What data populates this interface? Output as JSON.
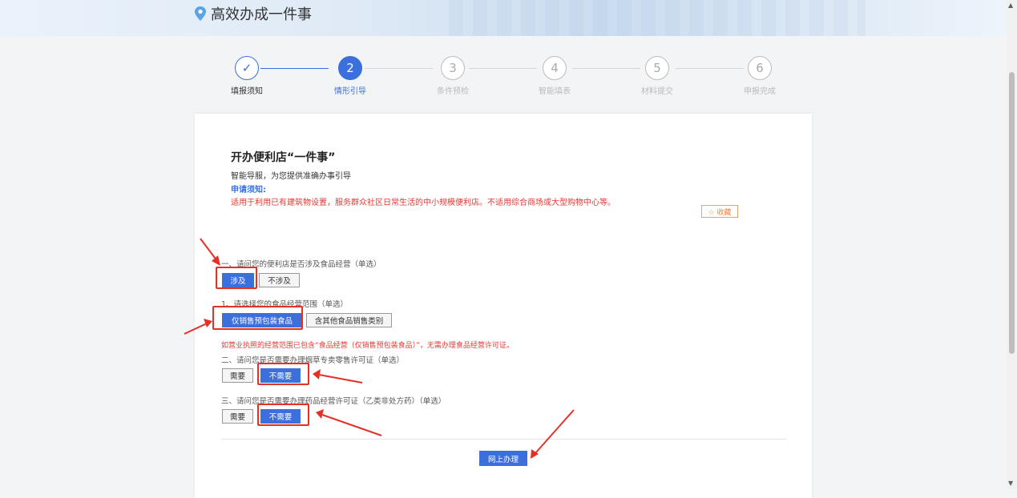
{
  "header": {
    "title": "高效办成一件事",
    "icon": "location-pin-icon"
  },
  "steps": [
    {
      "label": "填报须知",
      "number": "✓",
      "status": "done"
    },
    {
      "label": "情形引导",
      "number": "2",
      "status": "active"
    },
    {
      "label": "条件预检",
      "number": "3",
      "status": "pending"
    },
    {
      "label": "智能填表",
      "number": "4",
      "status": "pending"
    },
    {
      "label": "材料提交",
      "number": "5",
      "status": "pending"
    },
    {
      "label": "申报完成",
      "number": "6",
      "status": "pending"
    }
  ],
  "card": {
    "title": "开办便利店“一件事”",
    "subtitle": "智能导服，为您提供准确办事引导",
    "notice_label": "申请须知:",
    "notice_text": "适用于利用已有建筑物设置，服务群众社区日常生活的中小规模便利店。不适用综合商场或大型购物中心等。",
    "favorite_label": "☆ 收藏"
  },
  "questions": [
    {
      "text": "一、请问您的便利店是否涉及食品经营（单选）",
      "options": [
        "涉及",
        "不涉及"
      ],
      "selected": "涉及"
    },
    {
      "text": "1、请选择您的食品经营范围（单选）",
      "options": [
        "仅销售预包装食品",
        "含其他食品销售类别"
      ],
      "selected": "仅销售预包装食品"
    },
    {
      "text": "二、请问您是否需要办理烟草专卖零售许可证（单选）",
      "options": [
        "需要",
        "不需要"
      ],
      "selected": "不需要"
    },
    {
      "text": "三、请问您是否需要办理药品经营许可证（乙类非处方药）（单选）",
      "options": [
        "需要",
        "不需要"
      ],
      "selected": "不需要"
    }
  ],
  "warning": "如营业执照的经营范围已包含“食品经营（仅销售预包装食品）”，无需办理食品经营许可证。",
  "submit_label": "网上办理",
  "colors": {
    "accent": "#3b6fdc",
    "annotation_red": "#e53027",
    "notice_red": "#e53935"
  }
}
